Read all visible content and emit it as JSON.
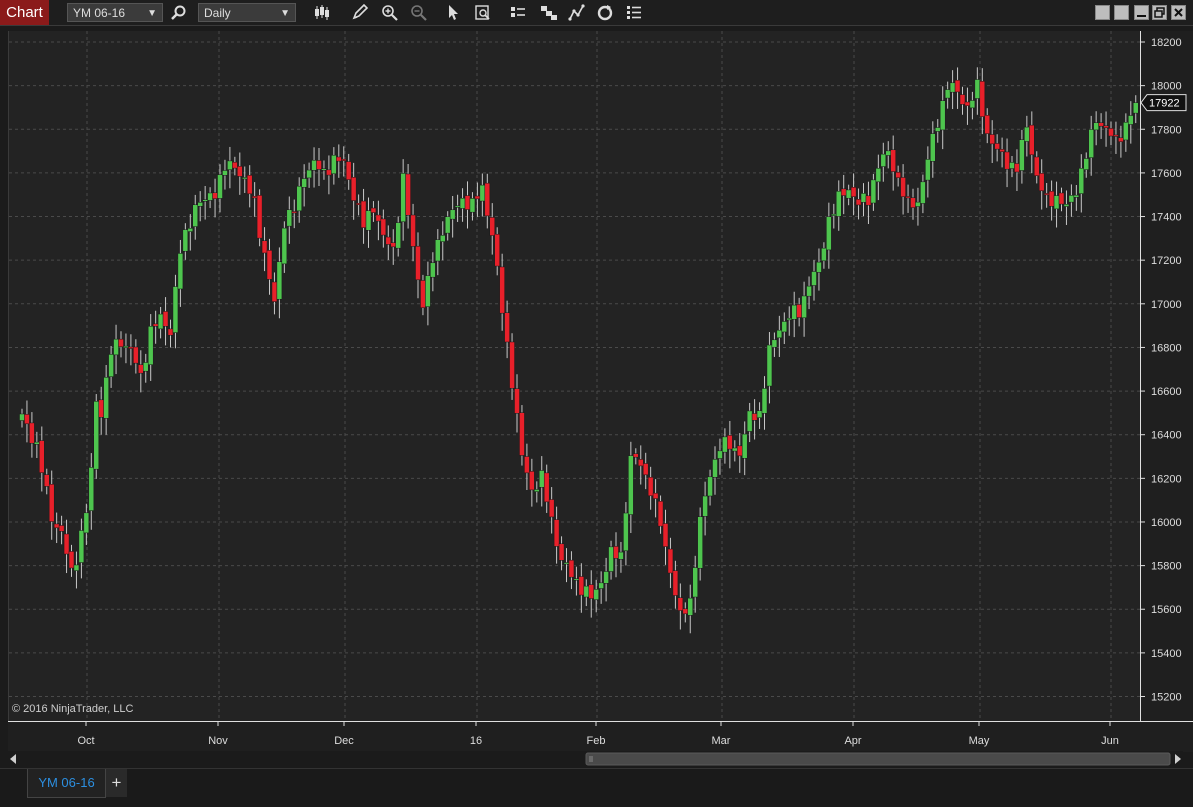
{
  "toolbar": {
    "title": "Chart",
    "instrument": "YM 06-16",
    "interval": "Daily",
    "icons": [
      "search-icon",
      "bar-type-icon",
      "pencil-draw-icon",
      "zoom-in-icon",
      "zoom-out-icon",
      "pointer-icon",
      "data-box-icon",
      "chart-trader-icon",
      "strategies-icon",
      "indicators-icon",
      "reload-icon",
      "properties-icon"
    ],
    "window_buttons": [
      "minimize",
      "maximize",
      "restore",
      "close"
    ]
  },
  "copyright": "© 2016 NinjaTrader, LLC",
  "price_marker": "17922",
  "tabs": [
    {
      "label": "YM 06-16"
    }
  ],
  "colors": {
    "up": "#4ec54e",
    "down": "#e8202a",
    "background": "#232323",
    "grid": "#4a4a4a"
  },
  "chart_data": {
    "type": "candlestick",
    "instrument": "YM 06-16",
    "interval": "Daily",
    "ylim": [
      15100,
      18250
    ],
    "y_ticks": [
      15200,
      15400,
      15600,
      15800,
      16000,
      16200,
      16400,
      16600,
      16800,
      17000,
      17200,
      17400,
      17600,
      17800,
      18000,
      18200
    ],
    "x_labels": [
      "Oct",
      "Nov",
      "Dec",
      "16",
      "Feb",
      "Mar",
      "Apr",
      "May",
      "Jun"
    ],
    "grid": true,
    "last_price": 17922,
    "keypoints": [
      [
        0,
        16480
      ],
      [
        3,
        16350
      ],
      [
        6,
        16020
      ],
      [
        8,
        15950
      ],
      [
        10,
        15760
      ],
      [
        11,
        15840
      ],
      [
        12,
        15950
      ],
      [
        13,
        16050
      ],
      [
        14,
        16230
      ],
      [
        15,
        16550
      ],
      [
        16,
        16510
      ],
      [
        18,
        16780
      ],
      [
        20,
        16830
      ],
      [
        22,
        16790
      ],
      [
        24,
        16660
      ],
      [
        26,
        16880
      ],
      [
        28,
        16930
      ],
      [
        30,
        16880
      ],
      [
        32,
        17240
      ],
      [
        35,
        17450
      ],
      [
        37,
        17470
      ],
      [
        39,
        17520
      ],
      [
        41,
        17620
      ],
      [
        43,
        17640
      ],
      [
        45,
        17560
      ],
      [
        47,
        17460
      ],
      [
        49,
        17220
      ],
      [
        51,
        17000
      ],
      [
        53,
        17380
      ],
      [
        55,
        17430
      ],
      [
        57,
        17600
      ],
      [
        59,
        17640
      ],
      [
        61,
        17600
      ],
      [
        63,
        17660
      ],
      [
        65,
        17650
      ],
      [
        67,
        17500
      ],
      [
        69,
        17360
      ],
      [
        71,
        17450
      ],
      [
        73,
        17300
      ],
      [
        75,
        17250
      ],
      [
        77,
        17570
      ],
      [
        79,
        17250
      ],
      [
        81,
        17000
      ],
      [
        83,
        17200
      ],
      [
        85,
        17350
      ],
      [
        87,
        17420
      ],
      [
        89,
        17480
      ],
      [
        91,
        17450
      ],
      [
        93,
        17530
      ],
      [
        95,
        17320
      ],
      [
        97,
        16970
      ],
      [
        99,
        16650
      ],
      [
        101,
        16300
      ],
      [
        103,
        16150
      ],
      [
        105,
        16200
      ],
      [
        107,
        16010
      ],
      [
        109,
        15820
      ],
      [
        111,
        15760
      ],
      [
        113,
        15700
      ],
      [
        115,
        15650
      ],
      [
        117,
        15730
      ],
      [
        119,
        15850
      ],
      [
        121,
        15850
      ],
      [
        123,
        16290
      ],
      [
        125,
        16270
      ],
      [
        127,
        16150
      ],
      [
        129,
        15990
      ],
      [
        131,
        15780
      ],
      [
        133,
        15560
      ],
      [
        135,
        15640
      ],
      [
        137,
        16000
      ],
      [
        139,
        16220
      ],
      [
        141,
        16350
      ],
      [
        143,
        16350
      ],
      [
        145,
        16320
      ],
      [
        147,
        16480
      ],
      [
        149,
        16500
      ],
      [
        151,
        16780
      ],
      [
        153,
        16890
      ],
      [
        155,
        16950
      ],
      [
        157,
        16960
      ],
      [
        159,
        17100
      ],
      [
        161,
        17170
      ],
      [
        163,
        17390
      ],
      [
        165,
        17480
      ],
      [
        167,
        17530
      ],
      [
        169,
        17460
      ],
      [
        171,
        17480
      ],
      [
        173,
        17640
      ],
      [
        175,
        17690
      ],
      [
        177,
        17570
      ],
      [
        179,
        17450
      ],
      [
        181,
        17470
      ],
      [
        183,
        17660
      ],
      [
        185,
        17840
      ],
      [
        187,
        18000
      ],
      [
        189,
        17970
      ],
      [
        191,
        17900
      ],
      [
        193,
        17990
      ],
      [
        195,
        17780
      ],
      [
        197,
        17700
      ],
      [
        199,
        17650
      ],
      [
        201,
        17620
      ],
      [
        203,
        17820
      ],
      [
        205,
        17580
      ],
      [
        207,
        17470
      ],
      [
        209,
        17490
      ],
      [
        211,
        17440
      ],
      [
        213,
        17530
      ],
      [
        215,
        17680
      ],
      [
        217,
        17850
      ],
      [
        219,
        17800
      ],
      [
        221,
        17740
      ],
      [
        223,
        17820
      ],
      [
        225,
        17922
      ]
    ]
  }
}
